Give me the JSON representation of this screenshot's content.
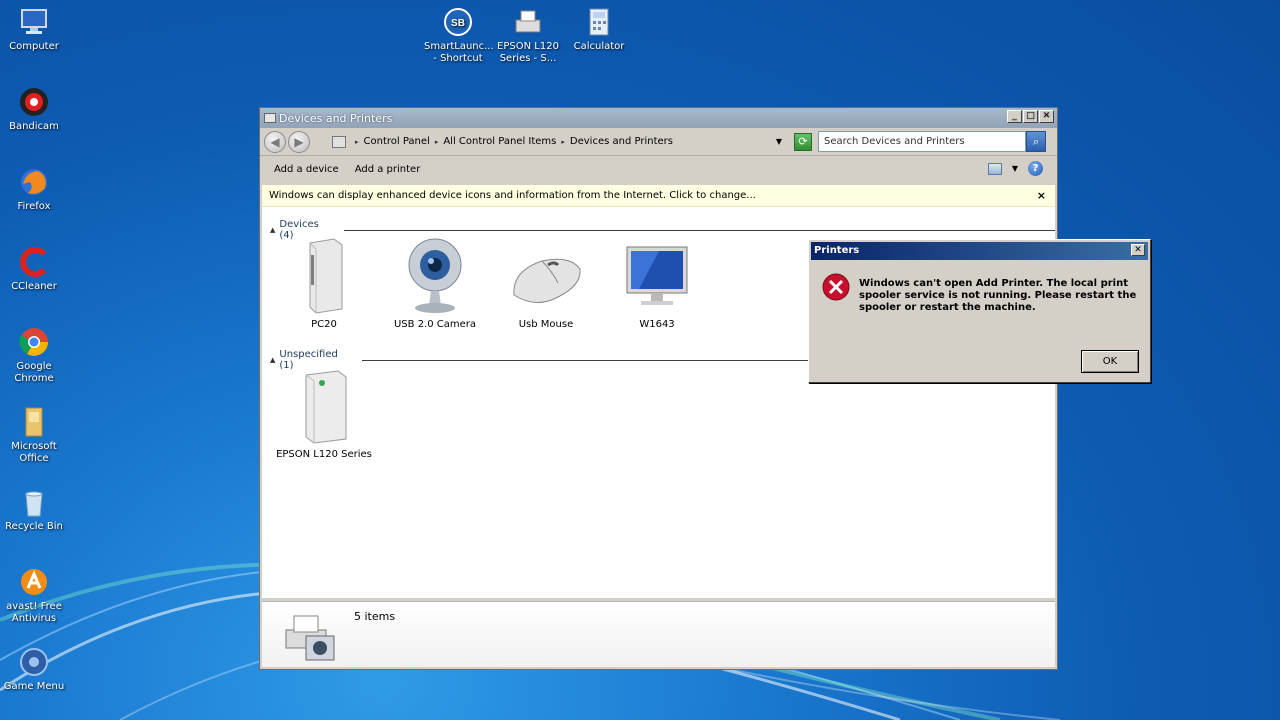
{
  "desktop": {
    "icons": [
      {
        "label": "Computer"
      },
      {
        "label": "Bandicam"
      },
      {
        "label": "Firefox"
      },
      {
        "label": "CCleaner"
      },
      {
        "label": "Google Chrome"
      },
      {
        "label": "Microsoft Office"
      },
      {
        "label": "Recycle Bin"
      },
      {
        "label": "avast! Free Antivirus"
      },
      {
        "label": "Game Menu"
      },
      {
        "label": "SmartLaunc... - Shortcut"
      },
      {
        "label": "EPSON L120 Series - S..."
      },
      {
        "label": "Calculator"
      }
    ]
  },
  "window": {
    "title": "Devices and Printers",
    "minimize": "_",
    "maximize": "□",
    "close": "✕",
    "back": "◀",
    "forward": "▶",
    "breadcrumb": [
      "Control Panel",
      "All Control Panel Items",
      "Devices and Printers"
    ],
    "breadcrumb_sep": "▸",
    "search_placeholder": "Search Devices and Printers",
    "commands": {
      "add_device": "Add a device",
      "add_printer": "Add a printer"
    },
    "infobar": {
      "text": "Windows can display enhanced device icons and information from the Internet. Click to change...",
      "close": "×"
    },
    "groups": {
      "devices": {
        "label": "Devices (4)",
        "items": [
          "PC20",
          "USB 2.0 Camera",
          "Usb Mouse",
          "W1643"
        ]
      },
      "unspecified": {
        "label": "Unspecified (1)",
        "items": [
          "EPSON L120 Series"
        ]
      }
    },
    "status": "5 items"
  },
  "dialog": {
    "title": "Printers",
    "close": "✕",
    "message": "Windows can't open Add Printer. The local print spooler service is not running. Please restart the spooler or restart the machine.",
    "ok_label": "OK"
  },
  "colors": {
    "desktop": "#1a78cf",
    "dialog_title": "#0a246a",
    "error": "#c8102e",
    "infobar": "#ffffe1"
  }
}
